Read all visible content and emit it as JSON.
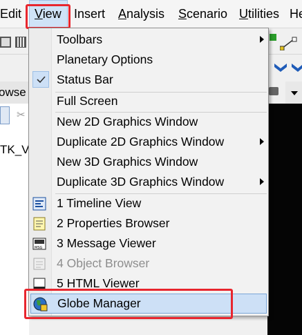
{
  "menubar": {
    "items": [
      {
        "label": "Edit",
        "mnemonic": ""
      },
      {
        "label": "View",
        "mnemonic": "V"
      },
      {
        "label": "Insert",
        "mnemonic": ""
      },
      {
        "label": "Analysis",
        "mnemonic": "A"
      },
      {
        "label": "Scenario",
        "mnemonic": "S"
      },
      {
        "label": "Utilities",
        "mnemonic": "U"
      },
      {
        "label": "Help",
        "mnemonic": ""
      }
    ],
    "active_item": "View"
  },
  "background": {
    "browser_label": "owse",
    "tree_item_label": "TK_Vo"
  },
  "view_menu": {
    "items": [
      {
        "id": "toolbars",
        "label": "Toolbars",
        "submenu": true
      },
      {
        "id": "planetary-options",
        "label": "Planetary Options"
      },
      {
        "id": "status-bar",
        "label": "Status Bar",
        "checked": true
      },
      {
        "id": "full-screen",
        "label": "Full Screen"
      },
      {
        "id": "new-2d",
        "label": "New 2D Graphics Window"
      },
      {
        "id": "dup-2d",
        "label": "Duplicate 2D Graphics Window",
        "submenu": true
      },
      {
        "id": "new-3d",
        "label": "New 3D Graphics Window"
      },
      {
        "id": "dup-3d",
        "label": "Duplicate 3D Graphics Window",
        "submenu": true
      },
      {
        "id": "timeline",
        "label": "1 Timeline View",
        "icon": "timeline-icon"
      },
      {
        "id": "properties",
        "label": "2 Properties Browser",
        "icon": "properties-icon"
      },
      {
        "id": "message",
        "label": "3 Message Viewer",
        "icon": "message-viewer-icon"
      },
      {
        "id": "object-browser",
        "label": "4 Object Browser",
        "icon": "object-browser-icon",
        "disabled": true
      },
      {
        "id": "html",
        "label": "5 HTML Viewer",
        "icon": "html-viewer-icon"
      },
      {
        "id": "globe-manager",
        "label": "Globe Manager",
        "icon": "globe-icon",
        "highlighted": true
      }
    ]
  },
  "colors": {
    "highlight_box": "#e8262e",
    "menu_hover": "#cde0f6",
    "disabled_text": "#8d8d8d"
  }
}
